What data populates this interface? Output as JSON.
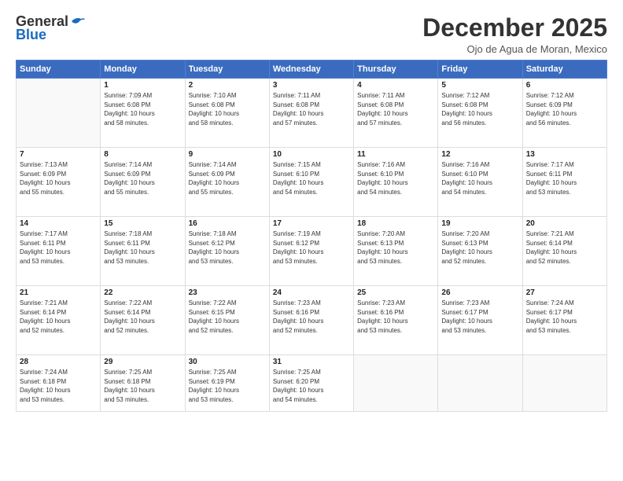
{
  "logo": {
    "general": "General",
    "blue": "Blue"
  },
  "title": "December 2025",
  "location": "Ojo de Agua de Moran, Mexico",
  "days_of_week": [
    "Sunday",
    "Monday",
    "Tuesday",
    "Wednesday",
    "Thursday",
    "Friday",
    "Saturday"
  ],
  "weeks": [
    [
      {
        "day": "",
        "info": ""
      },
      {
        "day": "1",
        "info": "Sunrise: 7:09 AM\nSunset: 6:08 PM\nDaylight: 10 hours\nand 58 minutes."
      },
      {
        "day": "2",
        "info": "Sunrise: 7:10 AM\nSunset: 6:08 PM\nDaylight: 10 hours\nand 58 minutes."
      },
      {
        "day": "3",
        "info": "Sunrise: 7:11 AM\nSunset: 6:08 PM\nDaylight: 10 hours\nand 57 minutes."
      },
      {
        "day": "4",
        "info": "Sunrise: 7:11 AM\nSunset: 6:08 PM\nDaylight: 10 hours\nand 57 minutes."
      },
      {
        "day": "5",
        "info": "Sunrise: 7:12 AM\nSunset: 6:08 PM\nDaylight: 10 hours\nand 56 minutes."
      },
      {
        "day": "6",
        "info": "Sunrise: 7:12 AM\nSunset: 6:09 PM\nDaylight: 10 hours\nand 56 minutes."
      }
    ],
    [
      {
        "day": "7",
        "info": "Sunrise: 7:13 AM\nSunset: 6:09 PM\nDaylight: 10 hours\nand 55 minutes."
      },
      {
        "day": "8",
        "info": "Sunrise: 7:14 AM\nSunset: 6:09 PM\nDaylight: 10 hours\nand 55 minutes."
      },
      {
        "day": "9",
        "info": "Sunrise: 7:14 AM\nSunset: 6:09 PM\nDaylight: 10 hours\nand 55 minutes."
      },
      {
        "day": "10",
        "info": "Sunrise: 7:15 AM\nSunset: 6:10 PM\nDaylight: 10 hours\nand 54 minutes."
      },
      {
        "day": "11",
        "info": "Sunrise: 7:16 AM\nSunset: 6:10 PM\nDaylight: 10 hours\nand 54 minutes."
      },
      {
        "day": "12",
        "info": "Sunrise: 7:16 AM\nSunset: 6:10 PM\nDaylight: 10 hours\nand 54 minutes."
      },
      {
        "day": "13",
        "info": "Sunrise: 7:17 AM\nSunset: 6:11 PM\nDaylight: 10 hours\nand 53 minutes."
      }
    ],
    [
      {
        "day": "14",
        "info": "Sunrise: 7:17 AM\nSunset: 6:11 PM\nDaylight: 10 hours\nand 53 minutes."
      },
      {
        "day": "15",
        "info": "Sunrise: 7:18 AM\nSunset: 6:11 PM\nDaylight: 10 hours\nand 53 minutes."
      },
      {
        "day": "16",
        "info": "Sunrise: 7:18 AM\nSunset: 6:12 PM\nDaylight: 10 hours\nand 53 minutes."
      },
      {
        "day": "17",
        "info": "Sunrise: 7:19 AM\nSunset: 6:12 PM\nDaylight: 10 hours\nand 53 minutes."
      },
      {
        "day": "18",
        "info": "Sunrise: 7:20 AM\nSunset: 6:13 PM\nDaylight: 10 hours\nand 53 minutes."
      },
      {
        "day": "19",
        "info": "Sunrise: 7:20 AM\nSunset: 6:13 PM\nDaylight: 10 hours\nand 52 minutes."
      },
      {
        "day": "20",
        "info": "Sunrise: 7:21 AM\nSunset: 6:14 PM\nDaylight: 10 hours\nand 52 minutes."
      }
    ],
    [
      {
        "day": "21",
        "info": "Sunrise: 7:21 AM\nSunset: 6:14 PM\nDaylight: 10 hours\nand 52 minutes."
      },
      {
        "day": "22",
        "info": "Sunrise: 7:22 AM\nSunset: 6:14 PM\nDaylight: 10 hours\nand 52 minutes."
      },
      {
        "day": "23",
        "info": "Sunrise: 7:22 AM\nSunset: 6:15 PM\nDaylight: 10 hours\nand 52 minutes."
      },
      {
        "day": "24",
        "info": "Sunrise: 7:23 AM\nSunset: 6:16 PM\nDaylight: 10 hours\nand 52 minutes."
      },
      {
        "day": "25",
        "info": "Sunrise: 7:23 AM\nSunset: 6:16 PM\nDaylight: 10 hours\nand 53 minutes."
      },
      {
        "day": "26",
        "info": "Sunrise: 7:23 AM\nSunset: 6:17 PM\nDaylight: 10 hours\nand 53 minutes."
      },
      {
        "day": "27",
        "info": "Sunrise: 7:24 AM\nSunset: 6:17 PM\nDaylight: 10 hours\nand 53 minutes."
      }
    ],
    [
      {
        "day": "28",
        "info": "Sunrise: 7:24 AM\nSunset: 6:18 PM\nDaylight: 10 hours\nand 53 minutes."
      },
      {
        "day": "29",
        "info": "Sunrise: 7:25 AM\nSunset: 6:18 PM\nDaylight: 10 hours\nand 53 minutes."
      },
      {
        "day": "30",
        "info": "Sunrise: 7:25 AM\nSunset: 6:19 PM\nDaylight: 10 hours\nand 53 minutes."
      },
      {
        "day": "31",
        "info": "Sunrise: 7:25 AM\nSunset: 6:20 PM\nDaylight: 10 hours\nand 54 minutes."
      },
      {
        "day": "",
        "info": ""
      },
      {
        "day": "",
        "info": ""
      },
      {
        "day": "",
        "info": ""
      }
    ]
  ]
}
